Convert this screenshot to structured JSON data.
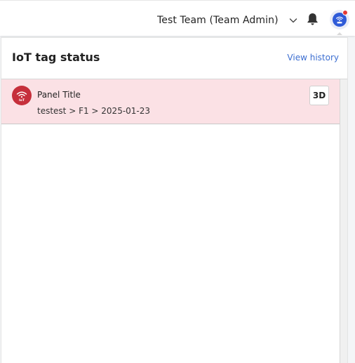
{
  "header": {
    "team_label": "Test Team (Team Admin)",
    "icons": [
      "chevron-down-icon",
      "bell-icon",
      "iot-avatar-icon"
    ],
    "colors": {
      "avatar_bg": "#2f5bd8",
      "notification_dot": "#e53935"
    }
  },
  "panel": {
    "title": "IoT tag status",
    "view_history_label": "View history",
    "rows": [
      {
        "title": "Panel Title",
        "path": "testest > F1 > 2025-01-23",
        "badge": "3D",
        "icon": "iot-wifi-icon",
        "status_color": "#fbe1e5"
      }
    ]
  }
}
